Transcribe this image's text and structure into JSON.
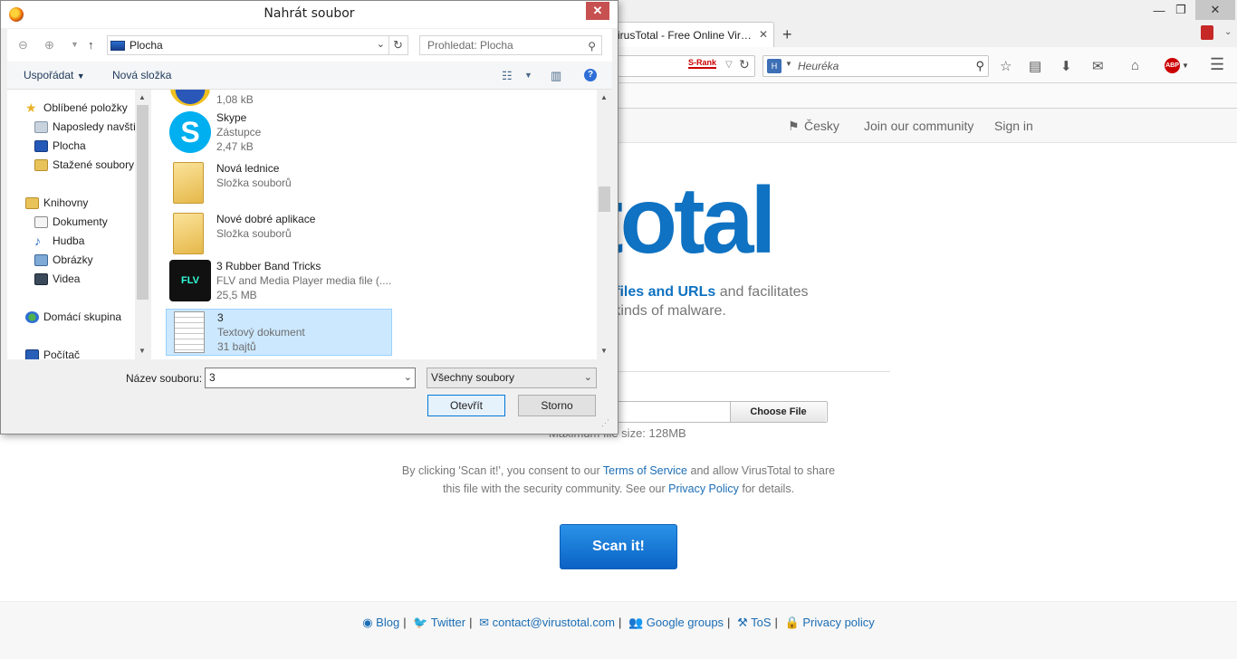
{
  "browser": {
    "tab_title": "irusTotal - Free Online Vir…",
    "tab_close": "✕",
    "newtab": "+",
    "srank": "S-Rank",
    "search_placeholder": "Heuréka",
    "window_controls": {
      "minimize": "—",
      "maximize": "❐",
      "close": "✕"
    },
    "abp": "ABP"
  },
  "vt": {
    "nav": {
      "language": "Česky",
      "community": "Join our community",
      "signin": "Sign in"
    },
    "logo_visible": "stotal",
    "tagline_bold": "uspicious files and URLs",
    "tagline_rest": " and facilitates",
    "tagline_line2": "ns, and all kinds of malware.",
    "choose_file": "Choose File",
    "max_size": "Maximum file size: 128MB",
    "consent_1": "By clicking 'Scan it!', you consent to our ",
    "consent_tos": "Terms of Service",
    "consent_2": " and allow VirusTotal to share this file with the security community. See our ",
    "consent_privacy": "Privacy Policy",
    "consent_3": " for details.",
    "scan_button": "Scan it!",
    "footer": {
      "blog": "Blog",
      "twitter": "Twitter",
      "email": "contact@virustotal.com",
      "groups": "Google groups",
      "tos": "ToS",
      "privacy": "Privacy policy"
    }
  },
  "dialog": {
    "title": "Nahrát soubor",
    "close": "✕",
    "path": "Plocha",
    "search_placeholder": "Prohledat: Plocha",
    "toolbar": {
      "organize": "Uspořádat",
      "new_folder": "Nová složka"
    },
    "nav_pane": {
      "favorites": "Oblíbené položky",
      "recent": "Naposledy navští",
      "desktop": "Plocha",
      "downloads": "Stažené soubory",
      "libraries": "Knihovny",
      "documents": "Dokumenty",
      "music": "Hudba",
      "pictures": "Obrázky",
      "videos": "Videa",
      "homegroup": "Domácí skupina",
      "computer": "Počítač"
    },
    "files": [
      {
        "name": "",
        "meta1": "1,08 kB",
        "meta2": ""
      },
      {
        "name": "Skype",
        "meta1": "Zástupce",
        "meta2": "2,47 kB"
      },
      {
        "name": "Nová lednice",
        "meta1": "Složka souborů",
        "meta2": ""
      },
      {
        "name": "Nové dobré aplikace",
        "meta1": "Složka souborů",
        "meta2": ""
      },
      {
        "name": "3 Rubber Band Tricks",
        "meta1": "FLV and Media Player media file (....",
        "meta2": "25,5 MB"
      },
      {
        "name": "3",
        "meta1": "Textový dokument",
        "meta2": "31 bajtů"
      }
    ],
    "filename_label": "Název souboru:",
    "filename_value": "3",
    "filetype_value": "Všechny soubory",
    "open_button": "Otevřít",
    "cancel_button": "Storno"
  },
  "colors": {
    "vt_blue": "#0f72c2",
    "selection": "#cce8ff",
    "close_red": "#c75050"
  }
}
